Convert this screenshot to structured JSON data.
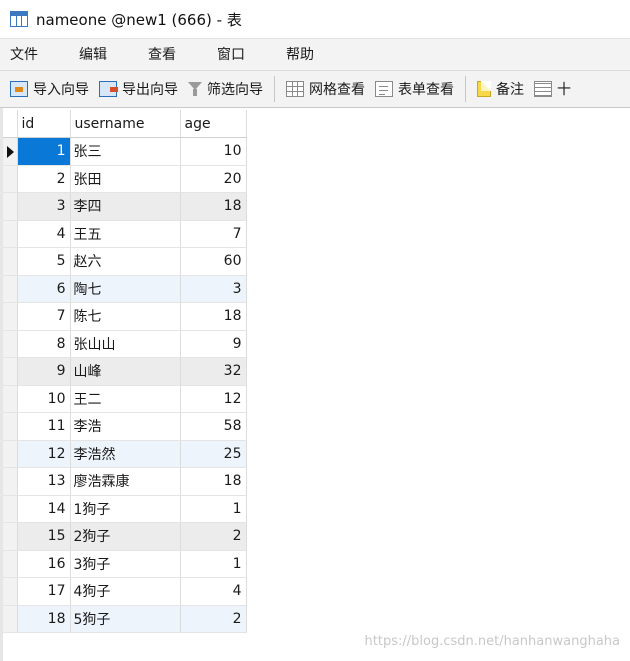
{
  "window": {
    "title": "nameone @new1 (666) - 表"
  },
  "menu": [
    "文件",
    "编辑",
    "查看",
    "窗口",
    "帮助"
  ],
  "toolbar": {
    "import_label": "导入向导",
    "export_label": "导出向导",
    "filter_label": "筛选向导",
    "grid_view_label": "网格查看",
    "form_view_label": "表单查看",
    "note_label": "备注",
    "hex_label": "十"
  },
  "columns": [
    "id",
    "username",
    "age"
  ],
  "rows": [
    {
      "id": "1",
      "username": "张三",
      "age": "10"
    },
    {
      "id": "2",
      "username": "张田",
      "age": "20"
    },
    {
      "id": "3",
      "username": "李四",
      "age": "18"
    },
    {
      "id": "4",
      "username": "王五",
      "age": "7"
    },
    {
      "id": "5",
      "username": "赵六",
      "age": "60"
    },
    {
      "id": "6",
      "username": "陶七",
      "age": "3"
    },
    {
      "id": "7",
      "username": "陈七",
      "age": "18"
    },
    {
      "id": "8",
      "username": "张山山",
      "age": "9"
    },
    {
      "id": "9",
      "username": "山峰",
      "age": "32"
    },
    {
      "id": "10",
      "username": "王二",
      "age": "12"
    },
    {
      "id": "11",
      "username": "李浩",
      "age": "58"
    },
    {
      "id": "12",
      "username": "李浩然",
      "age": "25"
    },
    {
      "id": "13",
      "username": "廖浩霖康",
      "age": "18"
    },
    {
      "id": "14",
      "username": "1狗子",
      "age": "1"
    },
    {
      "id": "15",
      "username": "2狗子",
      "age": "2"
    },
    {
      "id": "16",
      "username": "3狗子",
      "age": "1"
    },
    {
      "id": "17",
      "username": "4狗子",
      "age": "4"
    },
    {
      "id": "18",
      "username": "5狗子",
      "age": "2"
    }
  ],
  "selected_row_index": 0,
  "watermark": "https://blog.csdn.net/hanhanwanghaha",
  "colors": {
    "selection": "#0a78d7",
    "row_gray": "#ececec",
    "row_blue": "#eef4fb"
  }
}
